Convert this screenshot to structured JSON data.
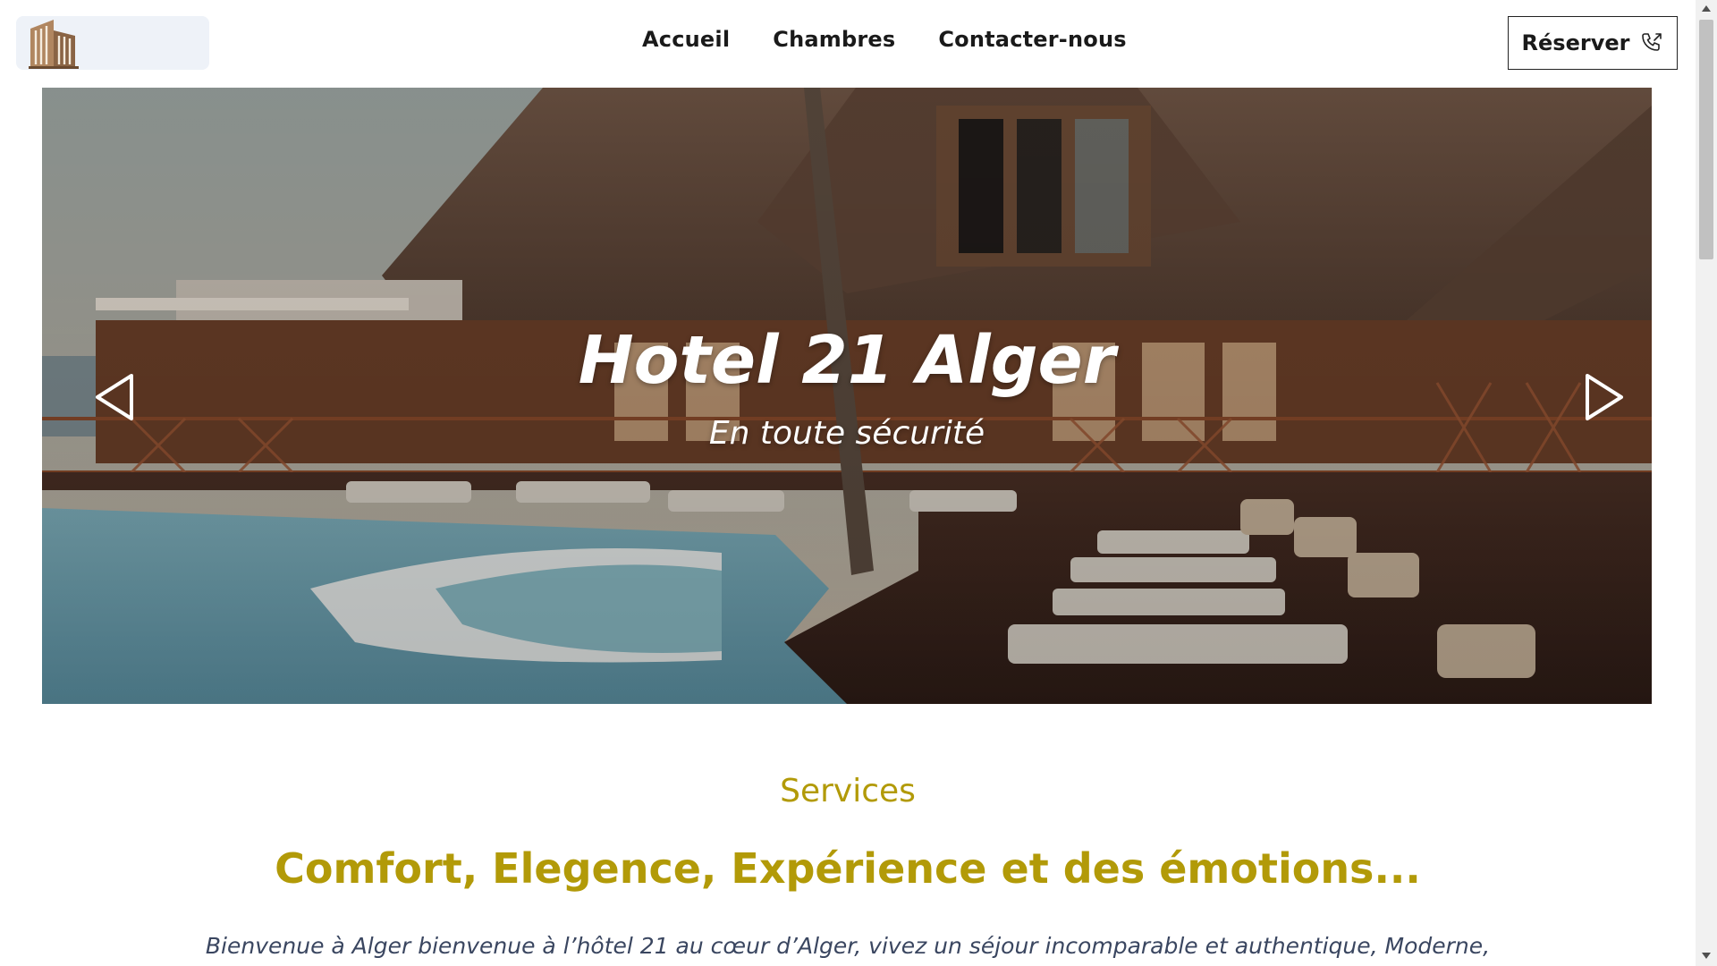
{
  "header": {
    "logo_icon": "hotel-building-icon",
    "nav": [
      "Accueil",
      "Chambres",
      "Contacter-nous"
    ],
    "reserve_label": "Réserver",
    "reserve_icon": "phone-icon"
  },
  "hero": {
    "title": "Hotel 21 Alger",
    "subtitle": "En toute sécurité",
    "prev_icon": "chevron-left-icon",
    "next_icon": "chevron-right-icon"
  },
  "services": {
    "label": "Services",
    "heading": "Comfort, Elegence, Expérience et des émotions...",
    "intro": "Bienvenue à Alger bienvenue à l’hôtel 21 au cœur d’Alger, vivez un séjour incomparable et authentique, Moderne,"
  },
  "colors": {
    "accent_gold": "#b29a08",
    "intro_text": "#3a4660"
  }
}
